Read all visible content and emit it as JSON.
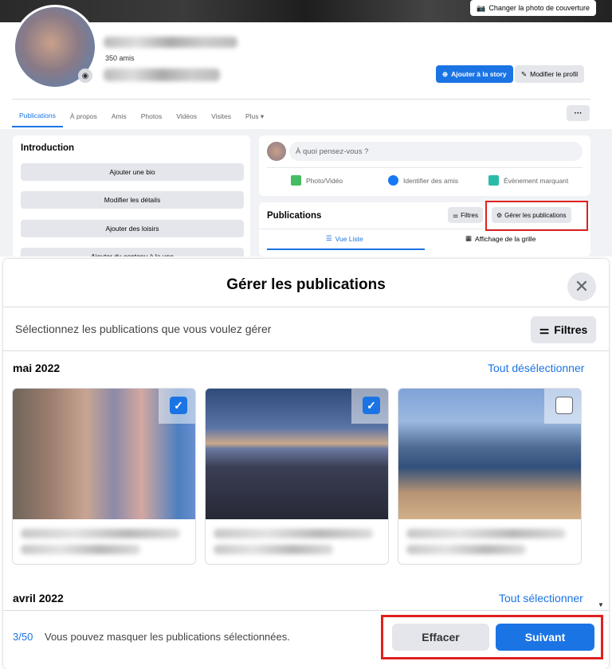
{
  "profile": {
    "cover_button": "Changer la photo de couverture",
    "friends_count": "350 amis",
    "add_story": "Ajouter à la story",
    "edit_profile": "Modifier le profil",
    "more_menu": "···"
  },
  "nav": {
    "items": [
      "Publications",
      "À propos",
      "Amis",
      "Photos",
      "Vidéos",
      "Visites",
      "Plus ▾"
    ]
  },
  "intro": {
    "title": "Introduction",
    "buttons": [
      "Ajouter une bio",
      "Modifier les détails",
      "Ajouter des loisirs",
      "Ajouter du contenu à la une"
    ]
  },
  "composer": {
    "placeholder": "À quoi pensez-vous ?",
    "actions": [
      "Photo/Vidéo",
      "Identifier des amis",
      "Évènement marquant"
    ]
  },
  "publications": {
    "title": "Publications",
    "filters": "Filtres",
    "manage": "Gérer les publications",
    "tab_list": "Vue Liste",
    "tab_grid": "Affichage de la grille"
  },
  "modal": {
    "title": "Gérer les publications",
    "subtitle": "Sélectionnez les publications que vous voulez gérer",
    "filters": "Filtres",
    "sections": [
      {
        "month": "mai 2022",
        "link": "Tout désélectionner"
      },
      {
        "month": "avril 2022",
        "link": "Tout sélectionner"
      }
    ],
    "posts": [
      {
        "checked": true
      },
      {
        "checked": true
      },
      {
        "checked": false
      }
    ],
    "footer": {
      "count": "3/50",
      "text": "Vous pouvez masquer les publications sélectionnées.",
      "clear": "Effacer",
      "next": "Suivant"
    }
  },
  "colors": {
    "accent": "#1b74e4",
    "highlight": "#e02020"
  }
}
